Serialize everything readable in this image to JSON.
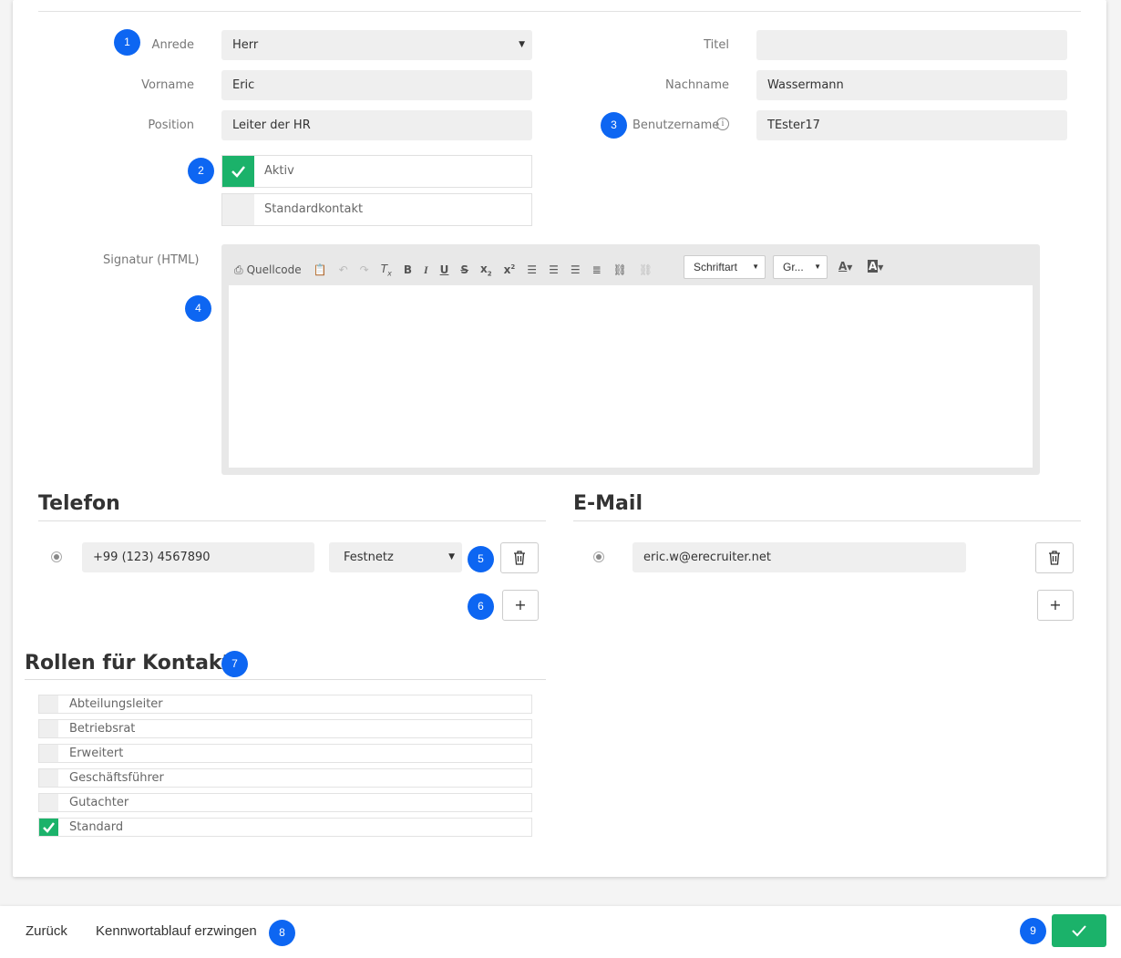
{
  "form": {
    "salutation": {
      "label": "Anrede",
      "value": "Herr"
    },
    "title": {
      "label": "Titel",
      "value": ""
    },
    "first_name": {
      "label": "Vorname",
      "value": "Eric"
    },
    "last_name": {
      "label": "Nachname",
      "value": "Wassermann"
    },
    "position": {
      "label": "Position",
      "value": "Leiter der HR"
    },
    "username": {
      "label": "Benutzername",
      "value": "TEster17",
      "info_icon": "info-icon"
    },
    "active": {
      "label": "Aktiv",
      "checked": true
    },
    "default_contact": {
      "label": "Standardkontakt",
      "checked": false
    },
    "signature": {
      "label": "Signatur (HTML)"
    }
  },
  "toolbar": {
    "source_label": "Quellcode",
    "font_label": "Schriftart",
    "size_label": "Gr...",
    "icons": [
      "source-icon",
      "paste-text-icon",
      "undo-icon",
      "redo-icon",
      "remove-format-icon",
      "bold-icon",
      "italic-icon",
      "underline-icon",
      "strikethrough-icon",
      "subscript-icon",
      "superscript-icon",
      "align-left-icon",
      "align-center-icon",
      "align-right-icon",
      "justify-icon",
      "link-icon",
      "unlink-icon",
      "text-color-icon",
      "background-color-icon"
    ]
  },
  "phone": {
    "heading": "Telefon",
    "number": "+99 (123) 4567890",
    "type": "Festnetz"
  },
  "email": {
    "heading": "E-Mail",
    "address": "eric.w@erecruiter.net"
  },
  "roles": {
    "heading": "Rollen für Kontakte",
    "items": [
      {
        "label": "Abteilungsleiter",
        "checked": false
      },
      {
        "label": "Betriebsrat",
        "checked": false
      },
      {
        "label": "Erweitert",
        "checked": false
      },
      {
        "label": "Geschäftsführer",
        "checked": false
      },
      {
        "label": "Gutachter",
        "checked": false
      },
      {
        "label": "Standard",
        "checked": true
      }
    ]
  },
  "footer": {
    "back_label": "Zurück",
    "force_pw_label": "Kennwortablauf erzwingen"
  },
  "badges": [
    "1",
    "2",
    "3",
    "4",
    "5",
    "6",
    "7",
    "8",
    "9"
  ],
  "colors": {
    "accent": "#1bb26a",
    "badge": "#0d66f2"
  }
}
